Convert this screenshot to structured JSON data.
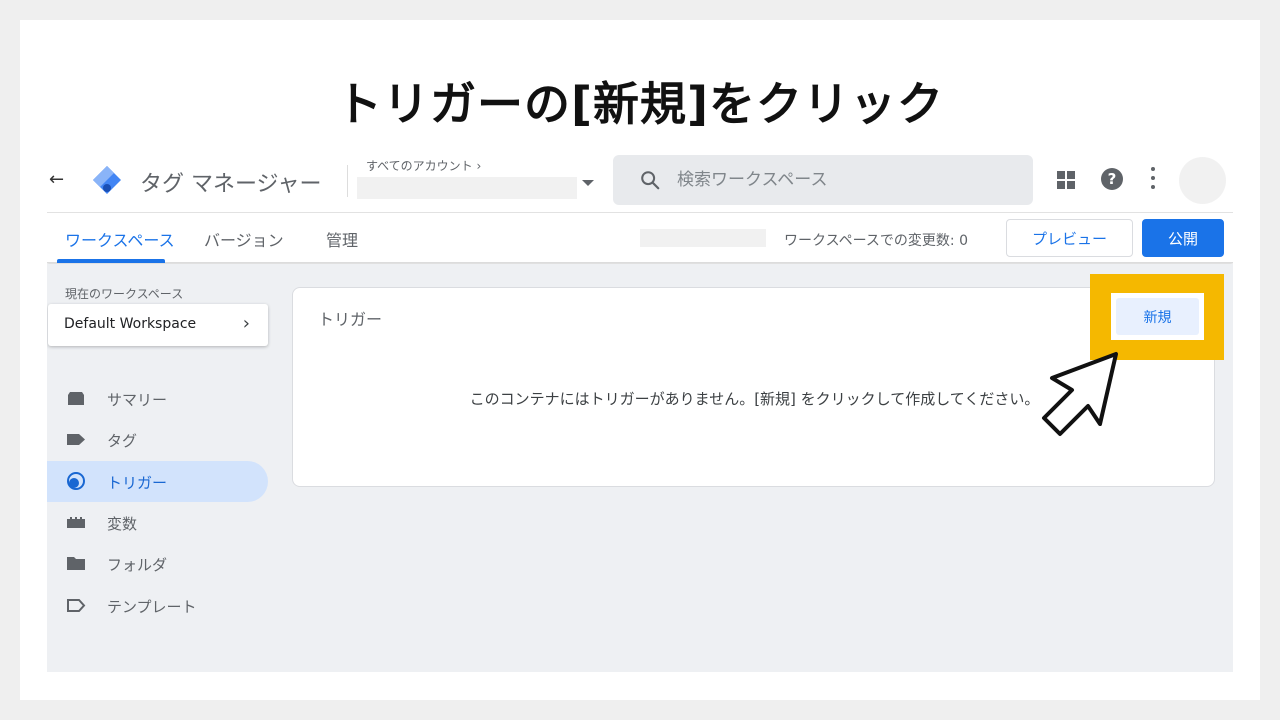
{
  "slide": {
    "title": "トリガーの[新規]をクリック"
  },
  "header": {
    "back_icon": "arrow-left-icon",
    "logo_icon": "gtm-diamond-icon",
    "product_name": "タグ マネージャー",
    "account_label": "すべてのアカウント ›",
    "search_placeholder": "検索ワークスペース",
    "icons": [
      "apps-grid-icon",
      "help-icon",
      "more-vert-icon"
    ]
  },
  "tabs": {
    "items": [
      {
        "label": "ワークスペース",
        "active": true
      },
      {
        "label": "バージョン",
        "active": false
      },
      {
        "label": "管理",
        "active": false
      }
    ],
    "change_count_label": "ワークスペースでの変更数: 0",
    "preview_label": "プレビュー",
    "publish_label": "公開"
  },
  "sidebar": {
    "workspace_label": "現在のワークスペース",
    "workspace_name": "Default Workspace",
    "items": [
      {
        "label": "サマリー",
        "icon": "summary-icon",
        "active": false
      },
      {
        "label": "タグ",
        "icon": "tag-icon",
        "active": false
      },
      {
        "label": "トリガー",
        "icon": "trigger-icon",
        "active": true
      },
      {
        "label": "変数",
        "icon": "variables-icon",
        "active": false
      },
      {
        "label": "フォルダ",
        "icon": "folder-icon",
        "active": false
      },
      {
        "label": "テンプレート",
        "icon": "template-icon",
        "active": false
      }
    ]
  },
  "main": {
    "card_title": "トリガー",
    "new_button_label": "新規",
    "empty_message": "このコンテナにはトリガーがありません。[新規] をクリックして作成してください。"
  },
  "colors": {
    "accent": "#1a73e8",
    "highlight": "#f5b800",
    "active_nav_bg": "#d2e3fc"
  }
}
